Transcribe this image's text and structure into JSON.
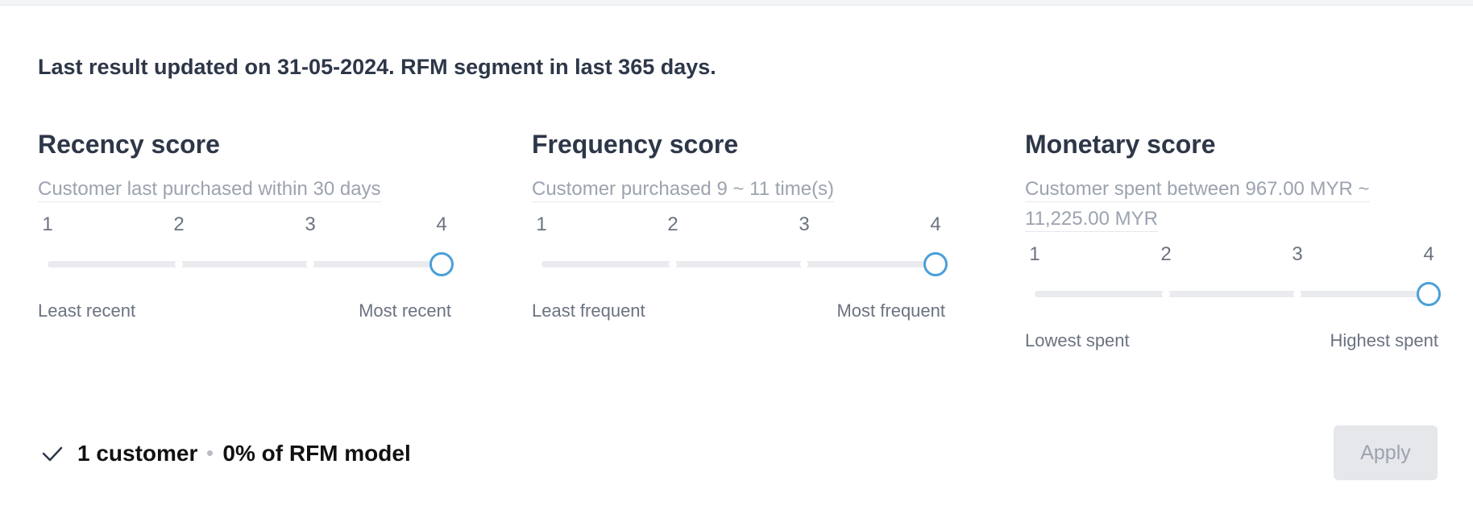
{
  "headline": "Last result updated on 31-05-2024. RFM segment in last 365 days.",
  "scores": [
    {
      "title": "Recency score",
      "description": "Customer last purchased within 30 days",
      "ticks": [
        "1",
        "2",
        "3",
        "4"
      ],
      "selected": 4,
      "min_label": "Least recent",
      "max_label": "Most recent"
    },
    {
      "title": "Frequency score",
      "description": "Customer purchased 9 ~ 11 time(s)",
      "ticks": [
        "1",
        "2",
        "3",
        "4"
      ],
      "selected": 4,
      "min_label": "Least frequent",
      "max_label": "Most frequent"
    },
    {
      "title": "Monetary score",
      "description": "Customer spent between 967.00 MYR ~ 11,225.00 MYR",
      "ticks": [
        "1",
        "2",
        "3",
        "4"
      ],
      "selected": 4,
      "min_label": "Lowest spent",
      "max_label": "Highest spent"
    }
  ],
  "footer": {
    "customer_count": "1 customer",
    "share": "0% of RFM model",
    "check_icon": "check-icon"
  },
  "apply_label": "Apply",
  "colors": {
    "accent": "#4a9fd8",
    "heading": "#2d3748",
    "muted": "#9ca3af",
    "track": "#e9ebee",
    "button_bg": "#e5e7eb"
  }
}
